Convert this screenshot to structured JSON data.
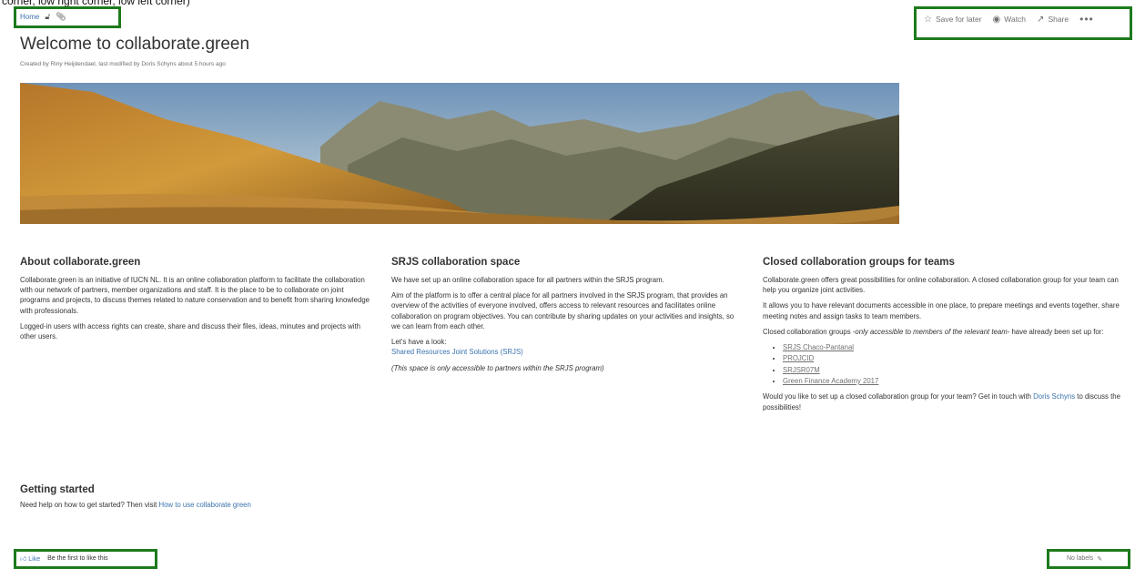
{
  "caption": "corner, low right corner, low left corner)",
  "breadcrumb": {
    "home": "Home",
    "lock_icon": "lock-icon",
    "attachment_icon": "paperclip-icon"
  },
  "actions": {
    "save": "Save for later",
    "watch": "Watch",
    "share": "Share",
    "more": "•••"
  },
  "page": {
    "title": "Welcome to collaborate.green",
    "meta": "Created by Riny Heijdendael, last modified by Doris Schyns about 5 hours ago"
  },
  "about": {
    "heading": "About collaborate.green",
    "p1": "Collaborate.green is an initiative of IUCN NL. It is an online collaboration platform to facilitate the collaboration with our network of partners, member organizations and staff. It is the place to be to collaborate on joint programs and projects, to discuss themes related to nature conservation and to benefit from sharing knowledge with professionals.",
    "p2": "Logged-in users with access rights can create, share and discuss their files, ideas, minutes and projects with other users."
  },
  "srjs": {
    "heading": "SRJS collaboration space",
    "p1": "We have set up an online collaboration space for all partners within the SRJS program.",
    "p2": "Aim of the platform is to offer a central place for all partners involved in the SRJS program, that provides an overview of the activities of everyone involved, offers access to relevant resources and facilitates online collaboration on program objectives. You can contribute by sharing updates on your activities and insights, so we can learn from each other.",
    "look": "Let's have a look:",
    "link": "Shared Resources Joint Solutions (SRJS)",
    "note": "(This space is only accessible to partners within the SRJS program)"
  },
  "closed": {
    "heading": "Closed collaboration groups for teams",
    "p1": "Collaborate.green offers great possibilities for online collaboration. A closed collaboration group for your team can help you organize joint activities.",
    "p2": "It allows you to have relevant documents accessible in one place, to prepare meetings and events together, share meeting notes and assign tasks to team members.",
    "p3_a": "Closed collaboration groups -",
    "p3_em": "only accessible to members of the relevant team",
    "p3_b": "- have already been set up for:",
    "groups": [
      "SRJS Chaco-Pantanal",
      "PROJCID",
      "SRJSR07M",
      "Green Finance Academy 2017"
    ],
    "p4_a": "Would you like to set up a closed collaboration group for your team? Get in touch with ",
    "p4_link": "Doris Schyns",
    "p4_b": " to discuss the possibilities!"
  },
  "getting": {
    "heading": "Getting started",
    "text": "Need help on how to get started? Then visit ",
    "link": "How to use collaborate green"
  },
  "footer": {
    "like": "Like",
    "first": "Be the first to like this",
    "labels": "No labels"
  }
}
